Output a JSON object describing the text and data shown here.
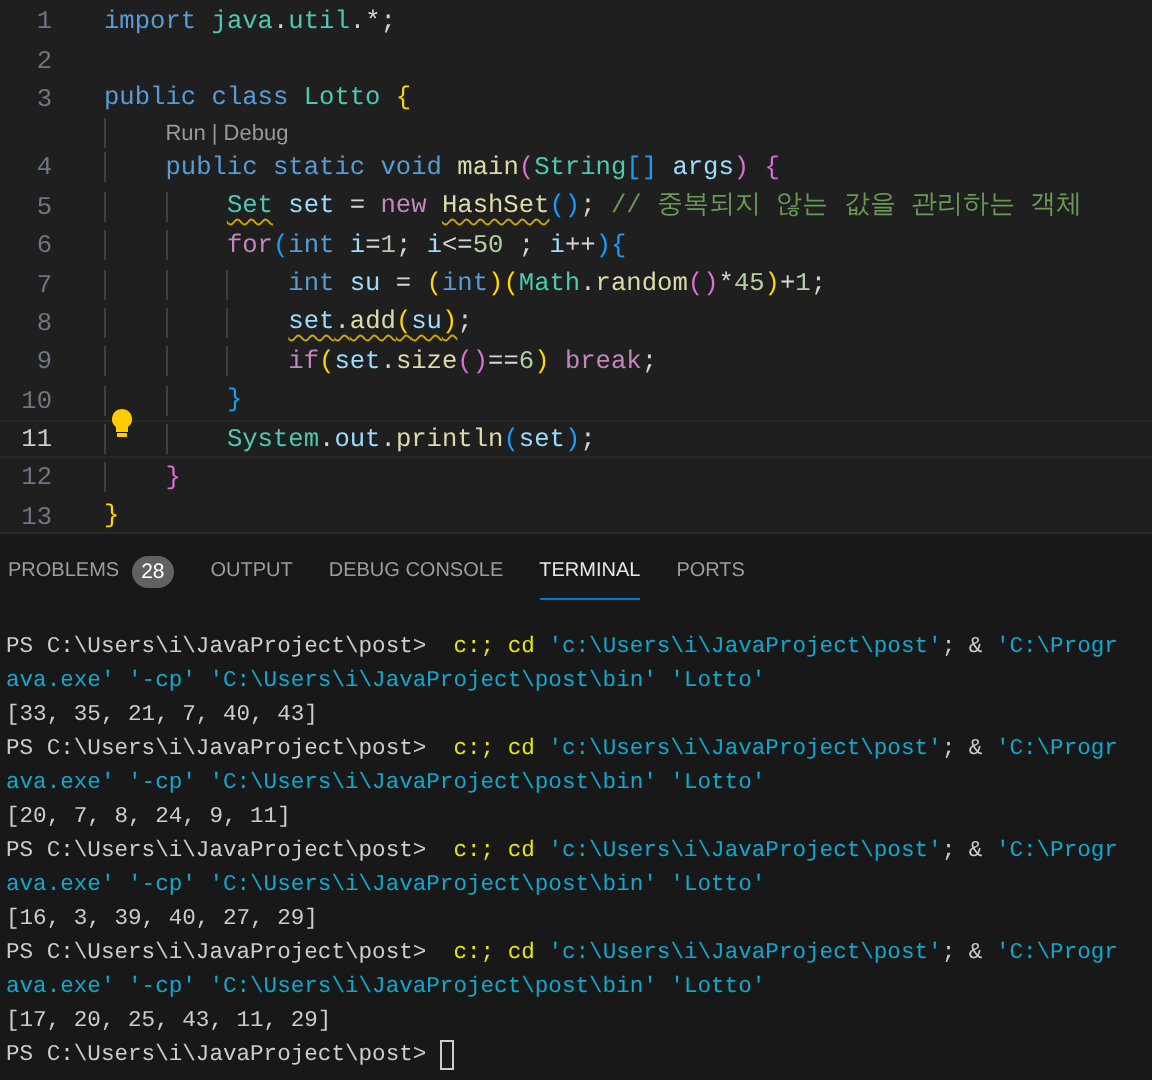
{
  "editor": {
    "lines": [
      {
        "kind": "code",
        "number": "1",
        "active": false,
        "lightbulb": false,
        "tokens": [
          {
            "text": "import ",
            "kind": "kw",
            "squiggle": false
          },
          {
            "text": "java",
            "kind": "type",
            "squiggle": false
          },
          {
            "text": ".",
            "kind": "p",
            "squiggle": false
          },
          {
            "text": "util",
            "kind": "type",
            "squiggle": false
          },
          {
            "text": ".*;",
            "kind": "p",
            "squiggle": false
          }
        ]
      },
      {
        "kind": "blank",
        "number": "2",
        "active": false,
        "lightbulb": false
      },
      {
        "kind": "code",
        "number": "3",
        "active": false,
        "lightbulb": false,
        "tokens": [
          {
            "text": "public ",
            "kind": "kw",
            "squiggle": false
          },
          {
            "text": "class ",
            "kind": "kw",
            "squiggle": false
          },
          {
            "text": "Lotto ",
            "kind": "type",
            "squiggle": false
          },
          {
            "text": "{",
            "kind": "b1",
            "squiggle": false
          }
        ]
      },
      {
        "kind": "codelens",
        "links": [
          "Run",
          "Debug"
        ],
        "separator": "|"
      },
      {
        "kind": "code",
        "number": "4",
        "active": false,
        "lightbulb": false,
        "tokens": [
          {
            "text": "    public ",
            "kind": "kw",
            "squiggle": false
          },
          {
            "text": "static ",
            "kind": "kw",
            "squiggle": false
          },
          {
            "text": "void ",
            "kind": "kw",
            "squiggle": false
          },
          {
            "text": "main",
            "kind": "fn",
            "squiggle": false
          },
          {
            "text": "(",
            "kind": "b2",
            "squiggle": false
          },
          {
            "text": "String",
            "kind": "type",
            "squiggle": false
          },
          {
            "text": "[] ",
            "kind": "b3",
            "squiggle": false
          },
          {
            "text": "args",
            "kind": "var",
            "squiggle": false
          },
          {
            "text": ") ",
            "kind": "b2",
            "squiggle": false
          },
          {
            "text": "{",
            "kind": "b2",
            "squiggle": false
          }
        ]
      },
      {
        "kind": "code",
        "number": "5",
        "active": false,
        "lightbulb": false,
        "tokens": [
          {
            "text": "        Set",
            "kind": "type",
            "squiggle": true
          },
          {
            "text": " set",
            "kind": "var",
            "squiggle": false
          },
          {
            "text": " = ",
            "kind": "p",
            "squiggle": false
          },
          {
            "text": "new ",
            "kind": "ctl",
            "squiggle": false
          },
          {
            "text": "HashSet",
            "kind": "fn",
            "squiggle": true
          },
          {
            "text": "(",
            "kind": "b3",
            "squiggle": false
          },
          {
            "text": ")",
            "kind": "b3",
            "squiggle": false
          },
          {
            "text": ";",
            "kind": "p",
            "squiggle": false
          },
          {
            "text": " // 중복되지 않는 값을 관리하는 객체",
            "kind": "cmt",
            "squiggle": false
          }
        ]
      },
      {
        "kind": "code",
        "number": "6",
        "active": false,
        "lightbulb": false,
        "tokens": [
          {
            "text": "        for",
            "kind": "ctl",
            "squiggle": false
          },
          {
            "text": "(",
            "kind": "b3",
            "squiggle": false
          },
          {
            "text": "int ",
            "kind": "kw",
            "squiggle": false
          },
          {
            "text": "i",
            "kind": "var",
            "squiggle": false
          },
          {
            "text": "=",
            "kind": "p",
            "squiggle": false
          },
          {
            "text": "1",
            "kind": "num",
            "squiggle": false
          },
          {
            "text": "; ",
            "kind": "p",
            "squiggle": false
          },
          {
            "text": "i",
            "kind": "var",
            "squiggle": false
          },
          {
            "text": "<=",
            "kind": "p",
            "squiggle": false
          },
          {
            "text": "50",
            "kind": "num",
            "squiggle": false
          },
          {
            "text": " ; ",
            "kind": "p",
            "squiggle": false
          },
          {
            "text": "i",
            "kind": "var",
            "squiggle": false
          },
          {
            "text": "++",
            "kind": "p",
            "squiggle": false
          },
          {
            "text": ")",
            "kind": "b3",
            "squiggle": false
          },
          {
            "text": "{",
            "kind": "b3",
            "squiggle": false
          }
        ]
      },
      {
        "kind": "code",
        "number": "7",
        "active": false,
        "lightbulb": false,
        "tokens": [
          {
            "text": "            int ",
            "kind": "kw",
            "squiggle": false
          },
          {
            "text": "su",
            "kind": "var",
            "squiggle": false
          },
          {
            "text": " = ",
            "kind": "p",
            "squiggle": false
          },
          {
            "text": "(",
            "kind": "b1",
            "squiggle": false
          },
          {
            "text": "int",
            "kind": "kw",
            "squiggle": false
          },
          {
            "text": ")",
            "kind": "b1",
            "squiggle": false
          },
          {
            "text": "(",
            "kind": "b1",
            "squiggle": false
          },
          {
            "text": "Math",
            "kind": "type",
            "squiggle": false
          },
          {
            "text": ".",
            "kind": "p",
            "squiggle": false
          },
          {
            "text": "random",
            "kind": "fn",
            "squiggle": false
          },
          {
            "text": "(",
            "kind": "b2",
            "squiggle": false
          },
          {
            "text": ")",
            "kind": "b2",
            "squiggle": false
          },
          {
            "text": "*",
            "kind": "p",
            "squiggle": false
          },
          {
            "text": "45",
            "kind": "num",
            "squiggle": false
          },
          {
            "text": ")",
            "kind": "b1",
            "squiggle": false
          },
          {
            "text": "+",
            "kind": "p",
            "squiggle": false
          },
          {
            "text": "1",
            "kind": "num",
            "squiggle": false
          },
          {
            "text": ";",
            "kind": "p",
            "squiggle": false
          }
        ]
      },
      {
        "kind": "code",
        "number": "8",
        "active": false,
        "lightbulb": false,
        "tokens": [
          {
            "text": "            set",
            "kind": "var",
            "squiggle": true
          },
          {
            "text": ".",
            "kind": "p",
            "squiggle": true
          },
          {
            "text": "add",
            "kind": "fn",
            "squiggle": true
          },
          {
            "text": "(",
            "kind": "b1",
            "squiggle": true
          },
          {
            "text": "su",
            "kind": "var",
            "squiggle": true
          },
          {
            "text": ")",
            "kind": "b1",
            "squiggle": true
          },
          {
            "text": ";",
            "kind": "p",
            "squiggle": false
          }
        ]
      },
      {
        "kind": "code",
        "number": "9",
        "active": false,
        "lightbulb": false,
        "tokens": [
          {
            "text": "            if",
            "kind": "ctl",
            "squiggle": false
          },
          {
            "text": "(",
            "kind": "b1",
            "squiggle": false
          },
          {
            "text": "set",
            "kind": "var",
            "squiggle": false
          },
          {
            "text": ".",
            "kind": "p",
            "squiggle": false
          },
          {
            "text": "size",
            "kind": "fn",
            "squiggle": false
          },
          {
            "text": "(",
            "kind": "b2",
            "squiggle": false
          },
          {
            "text": ")",
            "kind": "b2",
            "squiggle": false
          },
          {
            "text": "==",
            "kind": "p",
            "squiggle": false
          },
          {
            "text": "6",
            "kind": "num",
            "squiggle": false
          },
          {
            "text": ") ",
            "kind": "b1",
            "squiggle": false
          },
          {
            "text": "break",
            "kind": "ctl",
            "squiggle": false
          },
          {
            "text": ";",
            "kind": "p",
            "squiggle": false
          }
        ]
      },
      {
        "kind": "code",
        "number": "10",
        "active": false,
        "lightbulb": false,
        "tokens": [
          {
            "text": "        }",
            "kind": "b3",
            "squiggle": false
          }
        ]
      },
      {
        "kind": "code",
        "number": "11",
        "active": true,
        "lightbulb": true,
        "tokens": [
          {
            "text": "        System",
            "kind": "type",
            "squiggle": false
          },
          {
            "text": ".",
            "kind": "p",
            "squiggle": false
          },
          {
            "text": "out",
            "kind": "var",
            "squiggle": false
          },
          {
            "text": ".",
            "kind": "p",
            "squiggle": false
          },
          {
            "text": "println",
            "kind": "fn",
            "squiggle": false
          },
          {
            "text": "(",
            "kind": "b3",
            "squiggle": false
          },
          {
            "text": "set",
            "kind": "var",
            "squiggle": false
          },
          {
            "text": ")",
            "kind": "b3",
            "squiggle": false
          },
          {
            "text": ";",
            "kind": "p",
            "squiggle": false
          }
        ]
      },
      {
        "kind": "code",
        "number": "12",
        "active": false,
        "lightbulb": false,
        "tokens": [
          {
            "text": "    }",
            "kind": "b2",
            "squiggle": false
          }
        ]
      },
      {
        "kind": "code",
        "number": "13",
        "active": false,
        "lightbulb": false,
        "tokens": [
          {
            "text": "}",
            "kind": "b1",
            "squiggle": false
          }
        ]
      }
    ]
  },
  "panel": {
    "tabs": [
      {
        "label": "PROBLEMS",
        "badge": "28",
        "selected": false
      },
      {
        "label": "OUTPUT",
        "selected": false
      },
      {
        "label": "DEBUG CONSOLE",
        "selected": false
      },
      {
        "label": "TERMINAL",
        "selected": true
      },
      {
        "label": "PORTS",
        "selected": false
      }
    ],
    "terminal": [
      {
        "cursor": false,
        "tokens": [
          {
            "text": "PS C:\\Users\\i\\JavaProject\\post>",
            "kind": "plain"
          },
          {
            "text": "  c:;",
            "kind": "cmd"
          },
          {
            "text": " cd",
            "kind": "cmd"
          },
          {
            "text": " 'c:\\Users\\i\\JavaProject\\post'",
            "kind": "str"
          },
          {
            "text": "; & ",
            "kind": "plain"
          },
          {
            "text": "'C:\\Progr",
            "kind": "str"
          }
        ]
      },
      {
        "cursor": false,
        "tokens": [
          {
            "text": "ava.exe' '-cp' 'C:\\Users\\i\\JavaProject\\post\\bin' 'Lotto'",
            "kind": "str"
          }
        ]
      },
      {
        "cursor": false,
        "tokens": [
          {
            "text": "[33, 35, 21, 7, 40, 43]",
            "kind": "plain"
          }
        ]
      },
      {
        "cursor": false,
        "tokens": [
          {
            "text": "PS C:\\Users\\i\\JavaProject\\post>",
            "kind": "plain"
          },
          {
            "text": "  c:;",
            "kind": "cmd"
          },
          {
            "text": " cd",
            "kind": "cmd"
          },
          {
            "text": " 'c:\\Users\\i\\JavaProject\\post'",
            "kind": "str"
          },
          {
            "text": "; & ",
            "kind": "plain"
          },
          {
            "text": "'C:\\Progr",
            "kind": "str"
          }
        ]
      },
      {
        "cursor": false,
        "tokens": [
          {
            "text": "ava.exe' '-cp' 'C:\\Users\\i\\JavaProject\\post\\bin' 'Lotto'",
            "kind": "str"
          }
        ]
      },
      {
        "cursor": false,
        "tokens": [
          {
            "text": "[20, 7, 8, 24, 9, 11]",
            "kind": "plain"
          }
        ]
      },
      {
        "cursor": false,
        "tokens": [
          {
            "text": "PS C:\\Users\\i\\JavaProject\\post>",
            "kind": "plain"
          },
          {
            "text": "  c:;",
            "kind": "cmd"
          },
          {
            "text": " cd",
            "kind": "cmd"
          },
          {
            "text": " 'c:\\Users\\i\\JavaProject\\post'",
            "kind": "str"
          },
          {
            "text": "; & ",
            "kind": "plain"
          },
          {
            "text": "'C:\\Progr",
            "kind": "str"
          }
        ]
      },
      {
        "cursor": false,
        "tokens": [
          {
            "text": "ava.exe' '-cp' 'C:\\Users\\i\\JavaProject\\post\\bin' 'Lotto'",
            "kind": "str"
          }
        ]
      },
      {
        "cursor": false,
        "tokens": [
          {
            "text": "[16, 3, 39, 40, 27, 29]",
            "kind": "plain"
          }
        ]
      },
      {
        "cursor": false,
        "tokens": [
          {
            "text": "PS C:\\Users\\i\\JavaProject\\post>",
            "kind": "plain"
          },
          {
            "text": "  c:;",
            "kind": "cmd"
          },
          {
            "text": " cd",
            "kind": "cmd"
          },
          {
            "text": " 'c:\\Users\\i\\JavaProject\\post'",
            "kind": "str"
          },
          {
            "text": "; & ",
            "kind": "plain"
          },
          {
            "text": "'C:\\Progr",
            "kind": "str"
          }
        ]
      },
      {
        "cursor": false,
        "tokens": [
          {
            "text": "ava.exe' '-cp' 'C:\\Users\\i\\JavaProject\\post\\bin' 'Lotto'",
            "kind": "str"
          }
        ]
      },
      {
        "cursor": false,
        "tokens": [
          {
            "text": "[17, 20, 25, 43, 11, 29]",
            "kind": "plain"
          }
        ]
      },
      {
        "cursor": true,
        "tokens": [
          {
            "text": "PS C:\\Users\\i\\JavaProject\\post>",
            "kind": "plain"
          }
        ]
      }
    ]
  }
}
